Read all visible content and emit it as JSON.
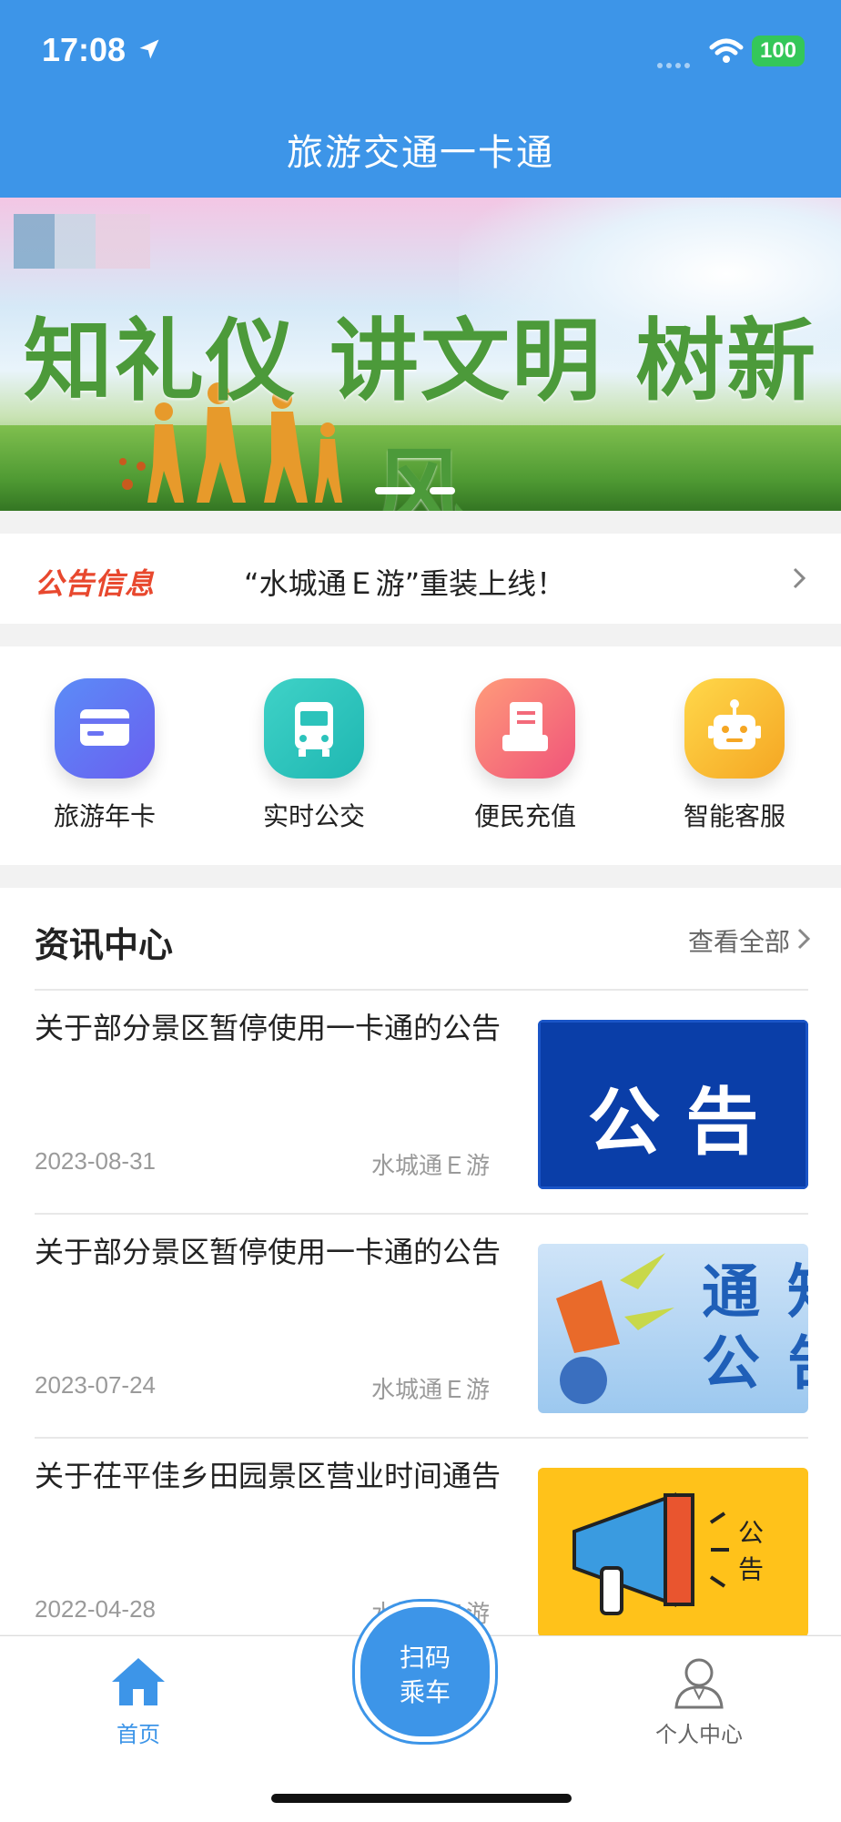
{
  "status_bar": {
    "time": "17:08",
    "battery": "100"
  },
  "header": {
    "title": "旅游交通一卡通"
  },
  "banner": {
    "slogan": "知礼仪 讲文明 树新风"
  },
  "notice": {
    "tag": "公告信息",
    "text": "“水城通Ｅ游”重装上线！"
  },
  "quick_actions": [
    {
      "label": "旅游年卡",
      "icon": "card-icon"
    },
    {
      "label": "实时公交",
      "icon": "bus-icon"
    },
    {
      "label": "便民充值",
      "icon": "recharge-icon"
    },
    {
      "label": "智能客服",
      "icon": "robot-icon"
    }
  ],
  "news": {
    "title": "资讯中心",
    "more": "查看全部",
    "items": [
      {
        "title": "关于部分景区暂停使用一卡通的公告",
        "date": "2023-08-31",
        "source": "水城通Ｅ游",
        "image_text": "公 告"
      },
      {
        "title": "关于部分景区暂停使用一卡通的公告",
        "date": "2023-07-24",
        "source": "水城通Ｅ游",
        "image_text_1": "通知",
        "image_text_2": "公告"
      },
      {
        "title": "关于茌平佳乡田园景区营业时间通告",
        "date": "2022-04-28",
        "source": "水城通Ｅ游",
        "image_text_1": "公",
        "image_text_2": "告"
      }
    ]
  },
  "bottom_nav": {
    "home": "首页",
    "scan_line1": "扫码",
    "scan_line2": "乘车",
    "profile": "个人中心"
  },
  "colors": {
    "primary": "#3d95e8",
    "notice_tag": "#e8482e"
  }
}
